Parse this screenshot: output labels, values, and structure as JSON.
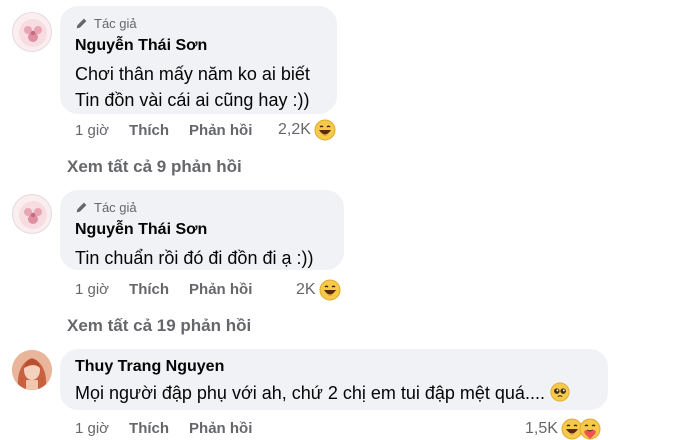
{
  "comments": [
    {
      "badge": "Tác giả",
      "author": "Nguyễn Thái Sơn",
      "lines": [
        "Chơi thân mấy năm ko ai biết",
        "Tin đồn vài cái ai cũng hay :))"
      ],
      "time": "1 giờ",
      "like_label": "Thích",
      "reply_label": "Phản hồi",
      "reaction_count": "2,2K",
      "reaction_icons": [
        "haha-emoji-icon"
      ],
      "view_replies": "Xem tất cả 9 phản hồi"
    },
    {
      "badge": "Tác giả",
      "author": "Nguyễn Thái Sơn",
      "lines": [
        "Tin chuẩn rồi đó đi đồn đi ạ :))"
      ],
      "time": "1 giờ",
      "like_label": "Thích",
      "reply_label": "Phản hồi",
      "reaction_count": "2K",
      "reaction_icons": [
        "haha-emoji-icon"
      ],
      "view_replies": "Xem tất cả 19 phản hồi"
    },
    {
      "author": "Thuy Trang Nguyen",
      "lines": [
        "Mọi người đập phụ với ah, chứ 2 chị em tui đập mệt quá.... "
      ],
      "trailing_emoji": "pleading-face-icon",
      "time": "1 giờ",
      "like_label": "Thích",
      "reply_label": "Phản hồi",
      "reaction_count": "1,5K",
      "reaction_icons": [
        "haha-emoji-icon",
        "care-emoji-icon"
      ]
    }
  ]
}
